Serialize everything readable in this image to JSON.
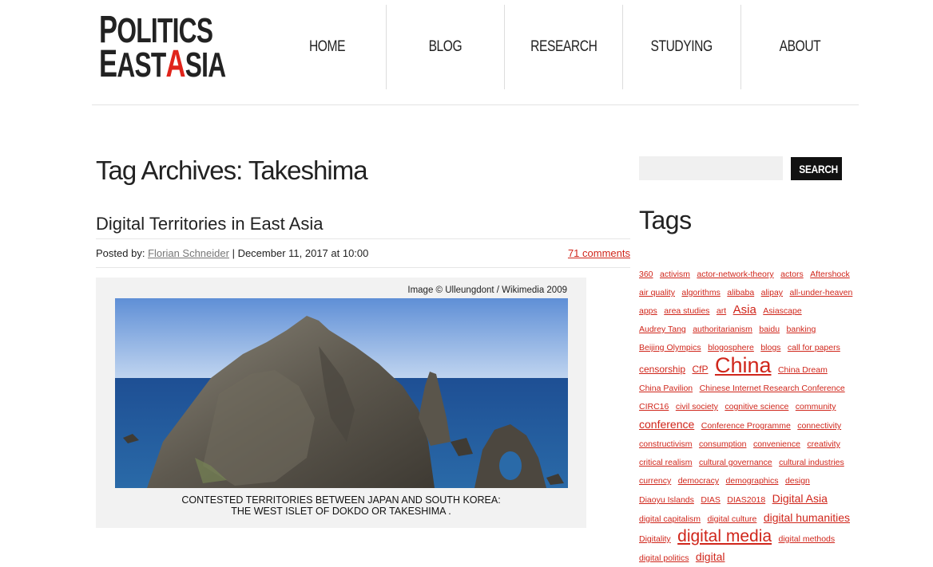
{
  "logo": {
    "line1_cap": "P",
    "line1_rest": "OLITICS",
    "line2_a": "E",
    "line2_b": "AST",
    "line2_red": "A",
    "line2_c": "SIA"
  },
  "nav": [
    {
      "label": "HOME"
    },
    {
      "label": "BLOG"
    },
    {
      "label": "RESEARCH"
    },
    {
      "label": "STUDYING"
    },
    {
      "label": "ABOUT"
    }
  ],
  "page": {
    "title": "Tag Archives: Takeshima"
  },
  "post": {
    "title": "Digital Territories in East Asia",
    "posted_by_label": "Posted by:",
    "author": "Florian Schneider",
    "date": "| December 11, 2017 at 10:00",
    "comments": "71 comments",
    "image_credit": "Image © Ulleungdont / Wikimedia 2009",
    "caption_line1": "CONTESTED TERRITORIES BETWEEN JAPAN AND SOUTH KOREA:",
    "caption_line2": "THE WEST ISLET OF DOKDO OR TAKESHIMA ."
  },
  "sidebar": {
    "search_placeholder": "",
    "search_button": "SEARCH",
    "tags_heading": "Tags",
    "tags": [
      {
        "label": "360",
        "size": "s1"
      },
      {
        "label": "activism",
        "size": "s1"
      },
      {
        "label": "actor-network-theory",
        "size": "s1"
      },
      {
        "label": "actors",
        "size": "s1"
      },
      {
        "label": "Aftershock",
        "size": "s1"
      },
      {
        "label": "air quality",
        "size": "s1"
      },
      {
        "label": "algorithms",
        "size": "s1"
      },
      {
        "label": "alibaba",
        "size": "s1"
      },
      {
        "label": "alipay",
        "size": "s1"
      },
      {
        "label": "all-under-heaven",
        "size": "s1"
      },
      {
        "label": "apps",
        "size": "s1"
      },
      {
        "label": "area studies",
        "size": "s1"
      },
      {
        "label": "art",
        "size": "s1"
      },
      {
        "label": "Asia",
        "size": "s4"
      },
      {
        "label": "Asiascape",
        "size": "s1"
      },
      {
        "label": "Audrey Tang",
        "size": "s1"
      },
      {
        "label": "authoritarianism",
        "size": "s1"
      },
      {
        "label": "baidu",
        "size": "s1"
      },
      {
        "label": "banking",
        "size": "s1"
      },
      {
        "label": "Beijing Olympics",
        "size": "s1"
      },
      {
        "label": "blogosphere",
        "size": "s1"
      },
      {
        "label": "blogs",
        "size": "s1"
      },
      {
        "label": "call for papers",
        "size": "s1"
      },
      {
        "label": "censorship",
        "size": "s2"
      },
      {
        "label": "CfP",
        "size": "s2"
      },
      {
        "label": "China",
        "size": "s6"
      },
      {
        "label": "China Dream",
        "size": "s1"
      },
      {
        "label": "China Pavilion",
        "size": "s1"
      },
      {
        "label": "Chinese Internet Research Conference",
        "size": "s1"
      },
      {
        "label": "CIRC16",
        "size": "s1"
      },
      {
        "label": "civil society",
        "size": "s1"
      },
      {
        "label": "cognitive science",
        "size": "s1"
      },
      {
        "label": "community",
        "size": "s1"
      },
      {
        "label": "conference",
        "size": "s3"
      },
      {
        "label": "Conference Programme",
        "size": "s1"
      },
      {
        "label": "connectivity",
        "size": "s1"
      },
      {
        "label": "constructivism",
        "size": "s1"
      },
      {
        "label": "consumption",
        "size": "s1"
      },
      {
        "label": "convenience",
        "size": "s1"
      },
      {
        "label": "creativity",
        "size": "s1"
      },
      {
        "label": "critical realism",
        "size": "s1"
      },
      {
        "label": "cultural governance",
        "size": "s1"
      },
      {
        "label": "cultural industries",
        "size": "s1"
      },
      {
        "label": "currency",
        "size": "s1"
      },
      {
        "label": "democracy",
        "size": "s1"
      },
      {
        "label": "demographics",
        "size": "s1"
      },
      {
        "label": "design",
        "size": "s1"
      },
      {
        "label": "Diaoyu Islands",
        "size": "s1"
      },
      {
        "label": "DIAS",
        "size": "s1"
      },
      {
        "label": "DIAS2018",
        "size": "s1"
      },
      {
        "label": "Digital Asia",
        "size": "s3"
      },
      {
        "label": "digital capitalism",
        "size": "s1"
      },
      {
        "label": "digital culture",
        "size": "s1"
      },
      {
        "label": "digital humanities",
        "size": "s3"
      },
      {
        "label": "Digitality",
        "size": "s1"
      },
      {
        "label": "digital media",
        "size": "s5"
      },
      {
        "label": "digital methods",
        "size": "s1"
      },
      {
        "label": "digital politics",
        "size": "s1"
      },
      {
        "label": "digital",
        "size": "s3"
      }
    ]
  }
}
